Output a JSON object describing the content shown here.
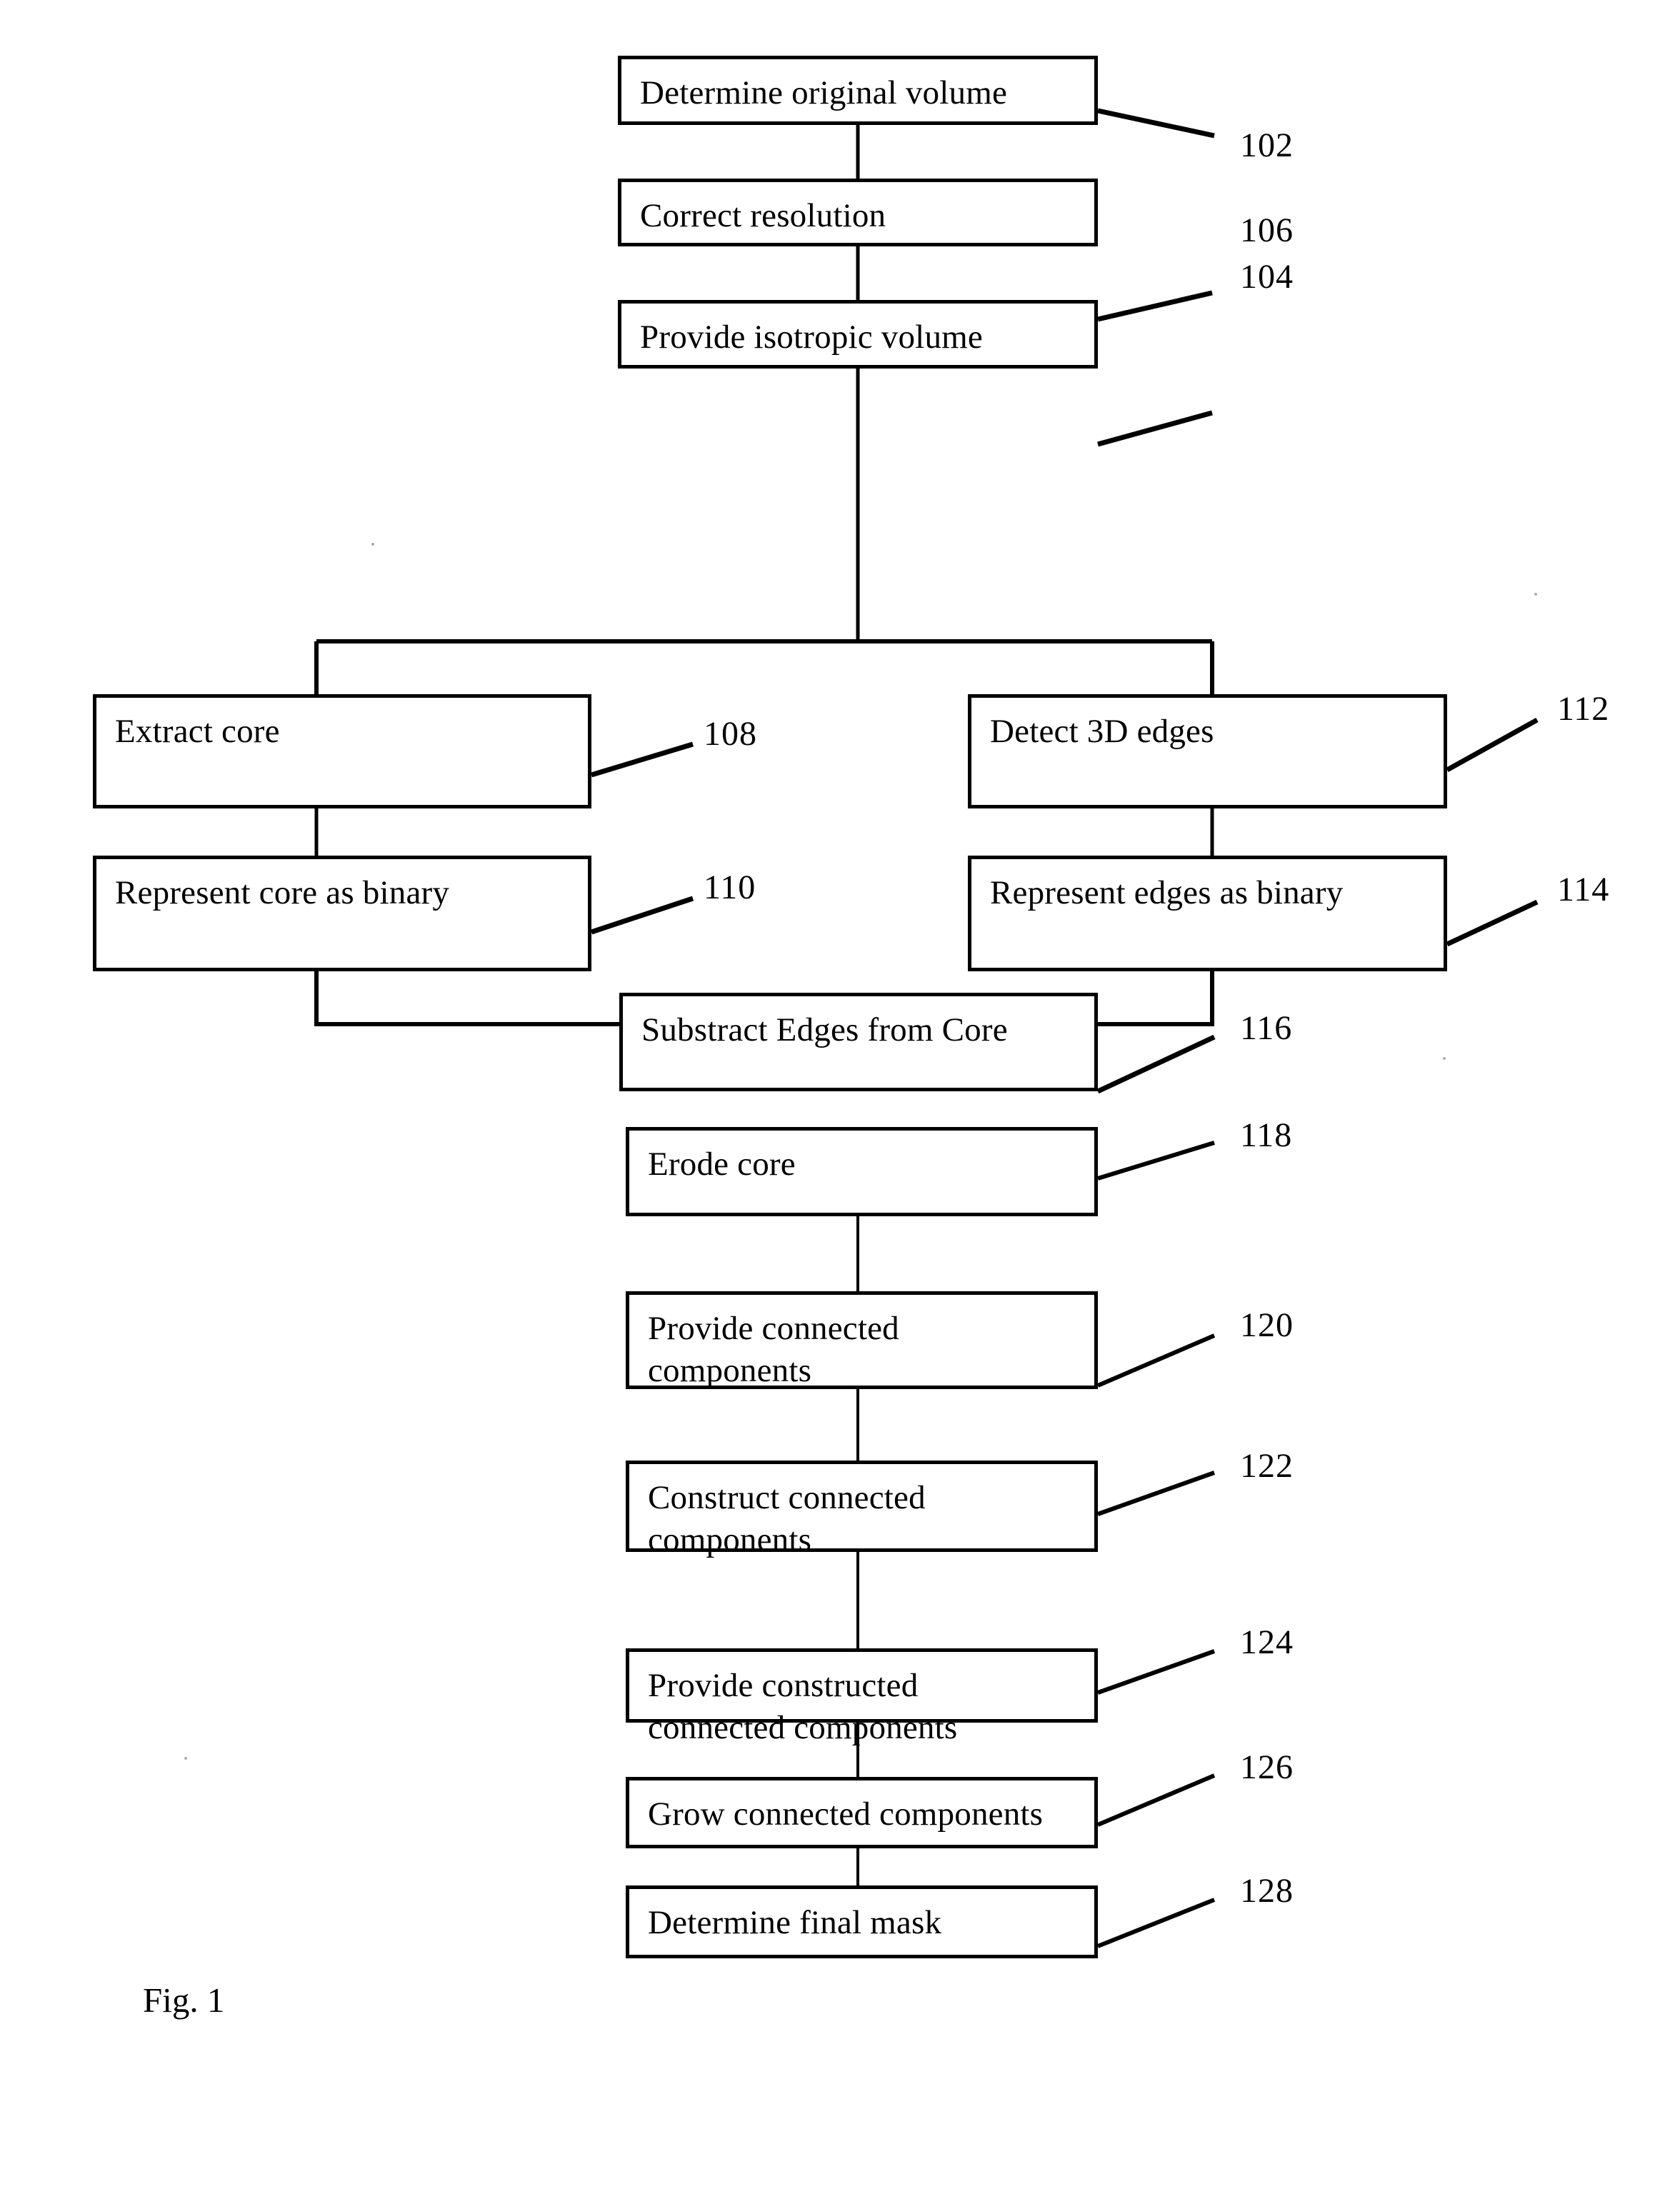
{
  "figure": {
    "caption": "Fig. 1",
    "type": "patent-flowchart"
  },
  "nodes": [
    {
      "id": "n102",
      "label": "Determine original volume",
      "label2": "",
      "ref": "102"
    },
    {
      "id": "n104",
      "label": "Correct resolution",
      "label2": "",
      "ref": "104"
    },
    {
      "id": "n106",
      "label": "Provide isotropic volume",
      "label2": "",
      "ref": "106"
    },
    {
      "id": "n108",
      "label": "Extract core",
      "label2": "",
      "ref": "108"
    },
    {
      "id": "n110",
      "label": "Represent core as binary",
      "label2": "",
      "ref": "110"
    },
    {
      "id": "n112",
      "label": "Detect 3D edges",
      "label2": "",
      "ref": "112"
    },
    {
      "id": "n114",
      "label": "Represent edges as binary",
      "label2": "",
      "ref": "114"
    },
    {
      "id": "n116",
      "label": "Substract Edges from Core",
      "label2": "",
      "ref": "116"
    },
    {
      "id": "n118",
      "label": "Erode core",
      "label2": "",
      "ref": "118"
    },
    {
      "id": "n120",
      "label": "Provide connected",
      "label2": "components",
      "ref": "120"
    },
    {
      "id": "n122",
      "label": "Construct connected",
      "label2": "components",
      "ref": "122"
    },
    {
      "id": "n124",
      "label": "Provide constructed",
      "label2": "connected components",
      "ref": "124"
    },
    {
      "id": "n126",
      "label": "Grow connected components",
      "label2": "",
      "ref": "126"
    },
    {
      "id": "n128",
      "label": "Determine final mask",
      "label2": "",
      "ref": "128"
    }
  ],
  "colors": {
    "stroke": "#000000",
    "background": "#ffffff"
  }
}
